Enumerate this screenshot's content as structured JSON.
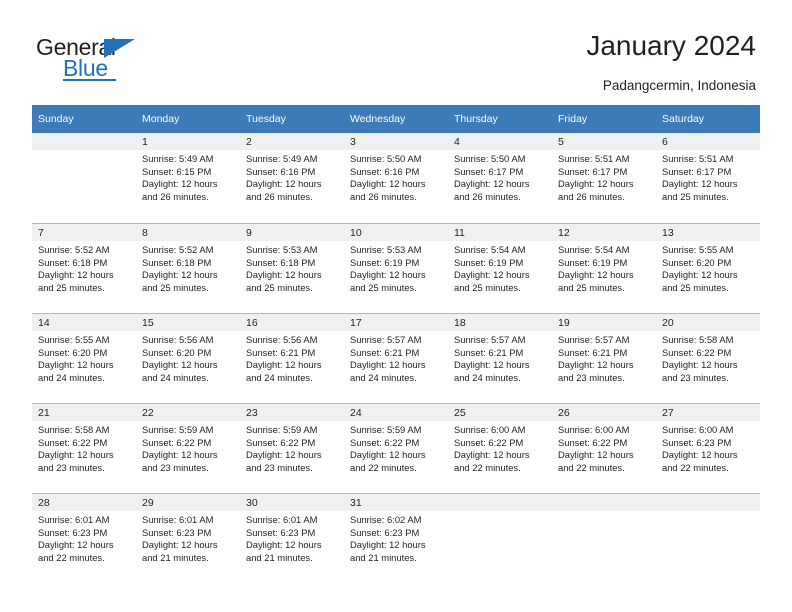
{
  "brand": {
    "name_top": "General",
    "name_bottom": "Blue",
    "logo_icon": "triangle-icon",
    "accent_color": "#2372b9"
  },
  "header": {
    "title": "January 2024",
    "location": "Padangcermin, Indonesia"
  },
  "calendar": {
    "header_bg": "#3c7ab8",
    "daynum_bg": "#f0f0f0",
    "weekday_headers": [
      "Sunday",
      "Monday",
      "Tuesday",
      "Wednesday",
      "Thursday",
      "Friday",
      "Saturday"
    ],
    "weeks": [
      [
        {
          "day": "",
          "sunrise": "",
          "sunset": "",
          "daylight_line1": "",
          "daylight_line2": ""
        },
        {
          "day": "1",
          "sunrise": "Sunrise: 5:49 AM",
          "sunset": "Sunset: 6:15 PM",
          "daylight_line1": "Daylight: 12 hours",
          "daylight_line2": "and 26 minutes."
        },
        {
          "day": "2",
          "sunrise": "Sunrise: 5:49 AM",
          "sunset": "Sunset: 6:16 PM",
          "daylight_line1": "Daylight: 12 hours",
          "daylight_line2": "and 26 minutes."
        },
        {
          "day": "3",
          "sunrise": "Sunrise: 5:50 AM",
          "sunset": "Sunset: 6:16 PM",
          "daylight_line1": "Daylight: 12 hours",
          "daylight_line2": "and 26 minutes."
        },
        {
          "day": "4",
          "sunrise": "Sunrise: 5:50 AM",
          "sunset": "Sunset: 6:17 PM",
          "daylight_line1": "Daylight: 12 hours",
          "daylight_line2": "and 26 minutes."
        },
        {
          "day": "5",
          "sunrise": "Sunrise: 5:51 AM",
          "sunset": "Sunset: 6:17 PM",
          "daylight_line1": "Daylight: 12 hours",
          "daylight_line2": "and 26 minutes."
        },
        {
          "day": "6",
          "sunrise": "Sunrise: 5:51 AM",
          "sunset": "Sunset: 6:17 PM",
          "daylight_line1": "Daylight: 12 hours",
          "daylight_line2": "and 25 minutes."
        }
      ],
      [
        {
          "day": "7",
          "sunrise": "Sunrise: 5:52 AM",
          "sunset": "Sunset: 6:18 PM",
          "daylight_line1": "Daylight: 12 hours",
          "daylight_line2": "and 25 minutes."
        },
        {
          "day": "8",
          "sunrise": "Sunrise: 5:52 AM",
          "sunset": "Sunset: 6:18 PM",
          "daylight_line1": "Daylight: 12 hours",
          "daylight_line2": "and 25 minutes."
        },
        {
          "day": "9",
          "sunrise": "Sunrise: 5:53 AM",
          "sunset": "Sunset: 6:18 PM",
          "daylight_line1": "Daylight: 12 hours",
          "daylight_line2": "and 25 minutes."
        },
        {
          "day": "10",
          "sunrise": "Sunrise: 5:53 AM",
          "sunset": "Sunset: 6:19 PM",
          "daylight_line1": "Daylight: 12 hours",
          "daylight_line2": "and 25 minutes."
        },
        {
          "day": "11",
          "sunrise": "Sunrise: 5:54 AM",
          "sunset": "Sunset: 6:19 PM",
          "daylight_line1": "Daylight: 12 hours",
          "daylight_line2": "and 25 minutes."
        },
        {
          "day": "12",
          "sunrise": "Sunrise: 5:54 AM",
          "sunset": "Sunset: 6:19 PM",
          "daylight_line1": "Daylight: 12 hours",
          "daylight_line2": "and 25 minutes."
        },
        {
          "day": "13",
          "sunrise": "Sunrise: 5:55 AM",
          "sunset": "Sunset: 6:20 PM",
          "daylight_line1": "Daylight: 12 hours",
          "daylight_line2": "and 25 minutes."
        }
      ],
      [
        {
          "day": "14",
          "sunrise": "Sunrise: 5:55 AM",
          "sunset": "Sunset: 6:20 PM",
          "daylight_line1": "Daylight: 12 hours",
          "daylight_line2": "and 24 minutes."
        },
        {
          "day": "15",
          "sunrise": "Sunrise: 5:56 AM",
          "sunset": "Sunset: 6:20 PM",
          "daylight_line1": "Daylight: 12 hours",
          "daylight_line2": "and 24 minutes."
        },
        {
          "day": "16",
          "sunrise": "Sunrise: 5:56 AM",
          "sunset": "Sunset: 6:21 PM",
          "daylight_line1": "Daylight: 12 hours",
          "daylight_line2": "and 24 minutes."
        },
        {
          "day": "17",
          "sunrise": "Sunrise: 5:57 AM",
          "sunset": "Sunset: 6:21 PM",
          "daylight_line1": "Daylight: 12 hours",
          "daylight_line2": "and 24 minutes."
        },
        {
          "day": "18",
          "sunrise": "Sunrise: 5:57 AM",
          "sunset": "Sunset: 6:21 PM",
          "daylight_line1": "Daylight: 12 hours",
          "daylight_line2": "and 24 minutes."
        },
        {
          "day": "19",
          "sunrise": "Sunrise: 5:57 AM",
          "sunset": "Sunset: 6:21 PM",
          "daylight_line1": "Daylight: 12 hours",
          "daylight_line2": "and 23 minutes."
        },
        {
          "day": "20",
          "sunrise": "Sunrise: 5:58 AM",
          "sunset": "Sunset: 6:22 PM",
          "daylight_line1": "Daylight: 12 hours",
          "daylight_line2": "and 23 minutes."
        }
      ],
      [
        {
          "day": "21",
          "sunrise": "Sunrise: 5:58 AM",
          "sunset": "Sunset: 6:22 PM",
          "daylight_line1": "Daylight: 12 hours",
          "daylight_line2": "and 23 minutes."
        },
        {
          "day": "22",
          "sunrise": "Sunrise: 5:59 AM",
          "sunset": "Sunset: 6:22 PM",
          "daylight_line1": "Daylight: 12 hours",
          "daylight_line2": "and 23 minutes."
        },
        {
          "day": "23",
          "sunrise": "Sunrise: 5:59 AM",
          "sunset": "Sunset: 6:22 PM",
          "daylight_line1": "Daylight: 12 hours",
          "daylight_line2": "and 23 minutes."
        },
        {
          "day": "24",
          "sunrise": "Sunrise: 5:59 AM",
          "sunset": "Sunset: 6:22 PM",
          "daylight_line1": "Daylight: 12 hours",
          "daylight_line2": "and 22 minutes."
        },
        {
          "day": "25",
          "sunrise": "Sunrise: 6:00 AM",
          "sunset": "Sunset: 6:22 PM",
          "daylight_line1": "Daylight: 12 hours",
          "daylight_line2": "and 22 minutes."
        },
        {
          "day": "26",
          "sunrise": "Sunrise: 6:00 AM",
          "sunset": "Sunset: 6:22 PM",
          "daylight_line1": "Daylight: 12 hours",
          "daylight_line2": "and 22 minutes."
        },
        {
          "day": "27",
          "sunrise": "Sunrise: 6:00 AM",
          "sunset": "Sunset: 6:23 PM",
          "daylight_line1": "Daylight: 12 hours",
          "daylight_line2": "and 22 minutes."
        }
      ],
      [
        {
          "day": "28",
          "sunrise": "Sunrise: 6:01 AM",
          "sunset": "Sunset: 6:23 PM",
          "daylight_line1": "Daylight: 12 hours",
          "daylight_line2": "and 22 minutes."
        },
        {
          "day": "29",
          "sunrise": "Sunrise: 6:01 AM",
          "sunset": "Sunset: 6:23 PM",
          "daylight_line1": "Daylight: 12 hours",
          "daylight_line2": "and 21 minutes."
        },
        {
          "day": "30",
          "sunrise": "Sunrise: 6:01 AM",
          "sunset": "Sunset: 6:23 PM",
          "daylight_line1": "Daylight: 12 hours",
          "daylight_line2": "and 21 minutes."
        },
        {
          "day": "31",
          "sunrise": "Sunrise: 6:02 AM",
          "sunset": "Sunset: 6:23 PM",
          "daylight_line1": "Daylight: 12 hours",
          "daylight_line2": "and 21 minutes."
        },
        {
          "day": "",
          "sunrise": "",
          "sunset": "",
          "daylight_line1": "",
          "daylight_line2": ""
        },
        {
          "day": "",
          "sunrise": "",
          "sunset": "",
          "daylight_line1": "",
          "daylight_line2": ""
        },
        {
          "day": "",
          "sunrise": "",
          "sunset": "",
          "daylight_line1": "",
          "daylight_line2": ""
        }
      ]
    ]
  }
}
